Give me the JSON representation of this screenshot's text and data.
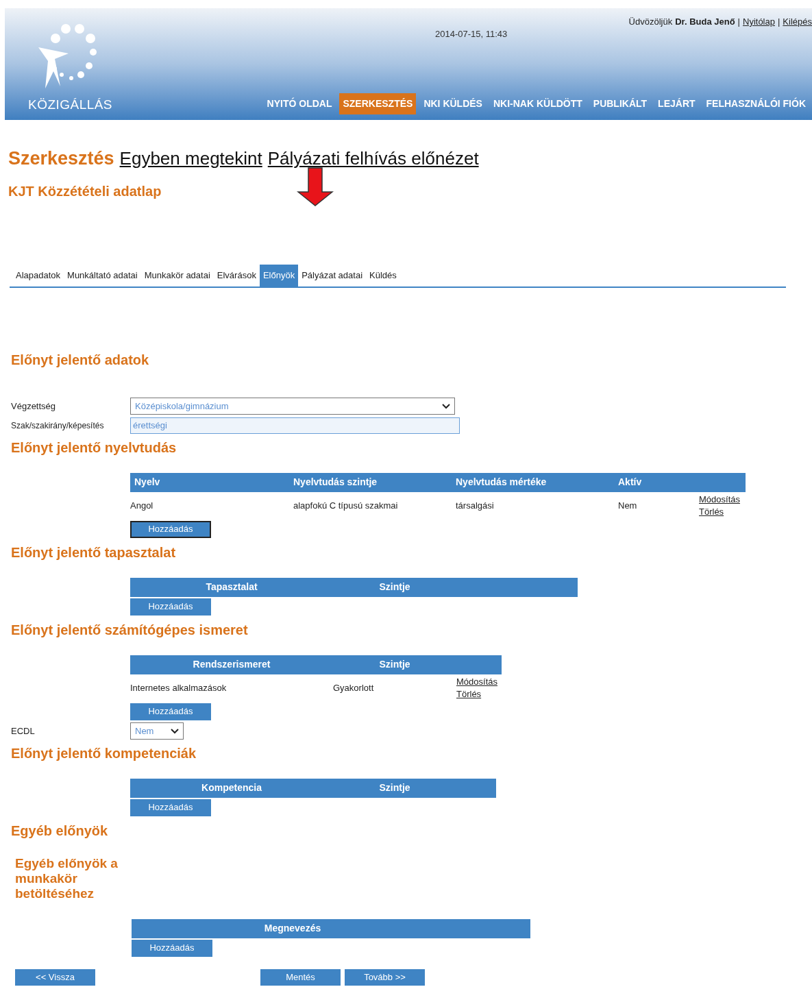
{
  "header": {
    "logo_text": "KÖZIGÁLLÁS",
    "datetime": "2014-07-15, 11:43",
    "greeting": "Üdvözöljük",
    "user": "Dr. Buda Jenő",
    "separator": "|",
    "links": [
      "Nyitólap",
      "Kilépés"
    ],
    "nav": [
      {
        "label": "NYITÓ OLDAL",
        "selected": false
      },
      {
        "label": "SZERKESZTÉS",
        "selected": true
      },
      {
        "label": "NKI KÜLDÉS",
        "selected": false
      },
      {
        "label": "NKI-NAK KÜLDÖTT",
        "selected": false
      },
      {
        "label": "PUBLIKÁLT",
        "selected": false
      },
      {
        "label": "LEJÁRT",
        "selected": false
      },
      {
        "label": "FELHASZNÁLÓI FIÓK",
        "selected": false
      }
    ]
  },
  "page_title": "Szerkesztés",
  "title_links": [
    "Egyben megtekint",
    "Pályázati felhívás előnézet"
  ],
  "subtitle": "KJT Közzétételi adatlap",
  "form_tabs": [
    {
      "label": "Alapadatok",
      "selected": false
    },
    {
      "label": "Munkáltató adatai",
      "selected": false
    },
    {
      "label": "Munkakör adatai",
      "selected": false
    },
    {
      "label": "Elvárások",
      "selected": false
    },
    {
      "label": "Előnyök",
      "selected": true
    },
    {
      "label": "Pályázat adatai",
      "selected": false
    },
    {
      "label": "Küldés",
      "selected": false
    }
  ],
  "blocks": [
    {
      "kind": "heading",
      "text": "Előnyt jelentő adatok"
    },
    {
      "kind": "select",
      "label": "Végzettség",
      "value": "Középiskola/gimnázium"
    },
    {
      "kind": "input",
      "label": "Szak/szakirány/képesítés",
      "value": "érettségi"
    },
    {
      "kind": "heading",
      "text": "Előnyt jelentő nyelvtudás"
    },
    {
      "kind": "table",
      "columns": [
        "Nyelv",
        "Nyelvtudás szintje",
        "Nyelvtudás mértéke",
        "Aktív"
      ],
      "rows": [
        {
          "cells": [
            "Angol",
            "alapfokú C típusú szakmai",
            "társalgási",
            "Nem"
          ],
          "actions": [
            "Módosítás",
            "Törlés"
          ]
        }
      ],
      "add_button": "Hozzáadás",
      "focused": true
    },
    {
      "kind": "heading",
      "text": "Előnyt jelentő tapasztalat"
    },
    {
      "kind": "table",
      "columns": [
        "Tapasztalat",
        "Szintje"
      ],
      "add_button": "Hozzáadás",
      "focused": false
    },
    {
      "kind": "heading",
      "text": "Előnyt jelentő számítógépes ismeret"
    },
    {
      "kind": "table",
      "columns": [
        "Rendszerismeret",
        "Szintje"
      ],
      "rows": [
        {
          "cells": [
            "Internetes alkalmazások",
            "Gyakorlott"
          ],
          "actions": [
            "Módosítás",
            "Törlés"
          ]
        }
      ],
      "add_button": "Hozzáadás",
      "focused": false
    },
    {
      "kind": "small_select",
      "label": "ECDL",
      "value": "Nem"
    },
    {
      "kind": "heading",
      "text": "Előnyt jelentő kompetenciák"
    },
    {
      "kind": "table",
      "columns": [
        "Kompetencia",
        "Szintje"
      ],
      "add_button": "Hozzáadás",
      "focused": false
    },
    {
      "kind": "heading",
      "text": "Egyéb előnyök"
    },
    {
      "kind": "subheading",
      "text": "Egyéb előnyök a munkakör betöltéséhez"
    },
    {
      "kind": "table",
      "columns": [
        "Megnevezés"
      ],
      "add_button": "Hozzáadás",
      "focused": false
    }
  ],
  "footer_buttons": [
    "<< Vissza",
    "Mentés",
    "Tovább >>"
  ]
}
